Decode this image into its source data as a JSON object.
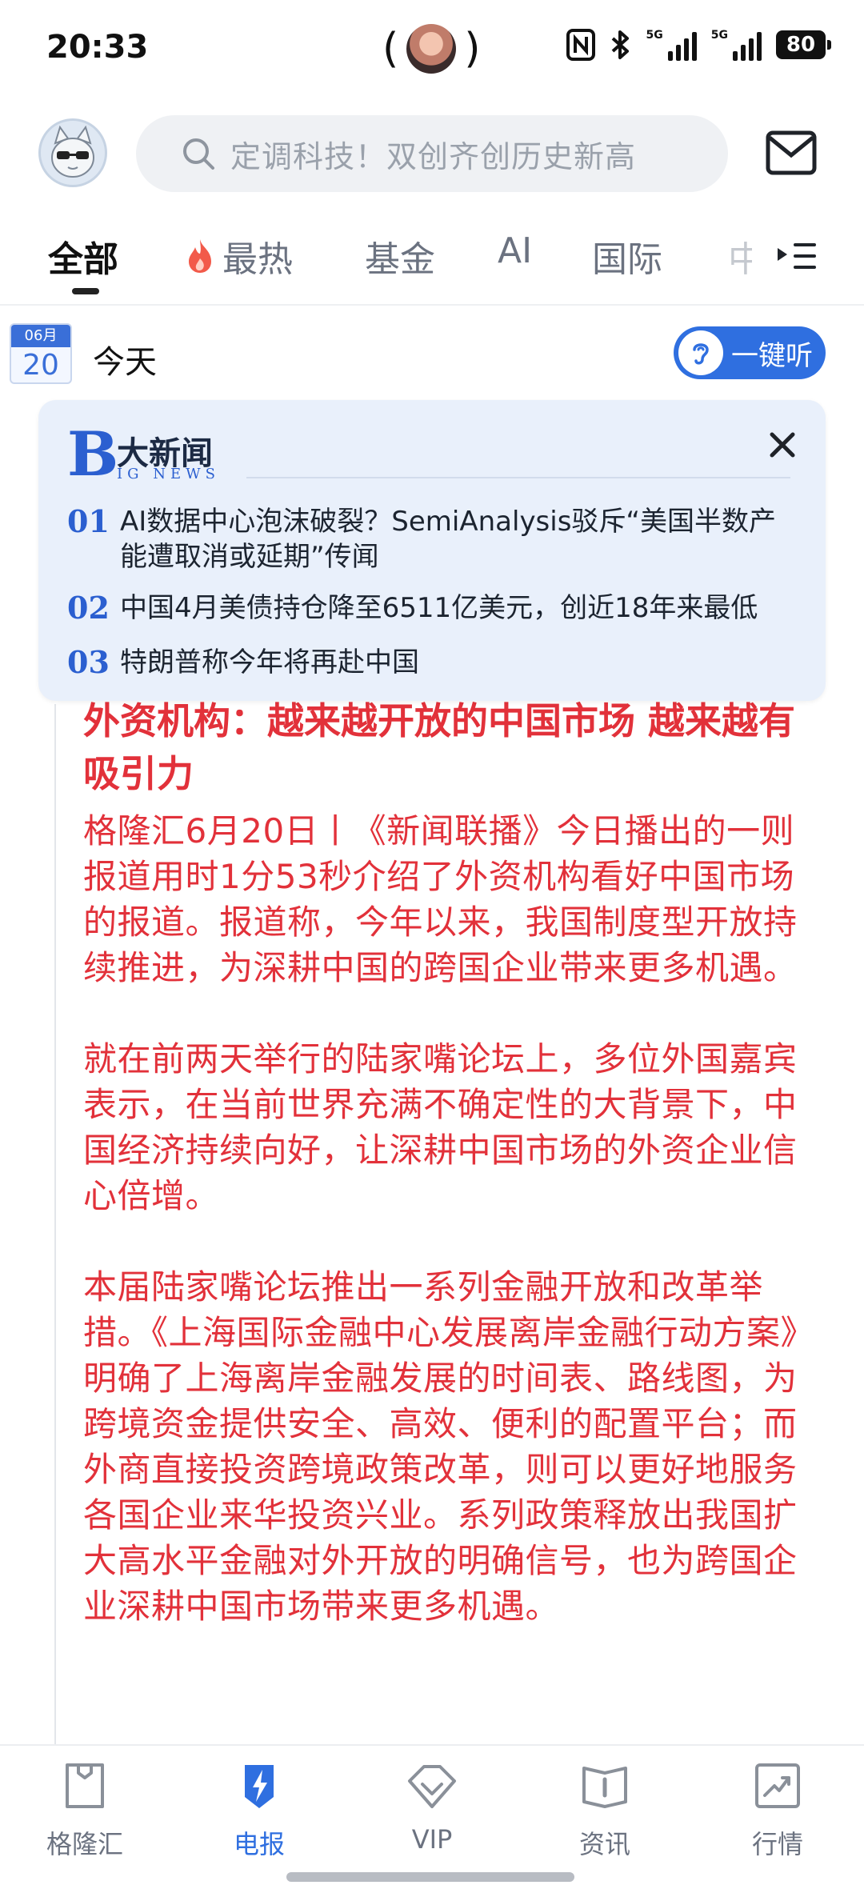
{
  "status_bar": {
    "time": "20:33",
    "network_1": "5G",
    "network_2": "5G",
    "battery": "80"
  },
  "header": {
    "search_placeholder": "定调科技！双创齐创历史新高"
  },
  "tabs": [
    {
      "label": "全部",
      "active": true
    },
    {
      "label": "最热"
    },
    {
      "label": "基金"
    },
    {
      "label": "AI"
    },
    {
      "label": "国际"
    },
    {
      "label": "中"
    }
  ],
  "date": {
    "month": "06月",
    "day": "20",
    "today_label": "今天",
    "listen_label": "一键听"
  },
  "big_news": {
    "logo_letter": "B",
    "logo_title": "大新闻",
    "logo_subtitle": "IG NEWS",
    "items": [
      {
        "num": "01",
        "text": "AI数据中心泡沫破裂？SemiAnalysis驳斥“美国半数产能遭取消或延期”传闻"
      },
      {
        "num": "02",
        "text": "中国4月美债持仓降至6511亿美元，创近18年来最低"
      },
      {
        "num": "03",
        "text": "特朗普称今年将再赴中国"
      }
    ]
  },
  "article": {
    "title": "外资机构：越来越开放的中国市场 越来越有吸引力",
    "paragraphs": [
      "格隆汇6月20日丨《新闻联播》今日播出的一则报道用时1分53秒介绍了外资机构看好中国市场的报道。报道称，今年以来，我国制度型开放持续推进，为深耕中国的跨国企业带来更多机遇。",
      "就在前两天举行的陆家嘴论坛上，多位外国嘉宾表示，在当前世界充满不确定性的大背景下，中国经济持续向好，让深耕中国市场的外资企业信心倍增。",
      "本届陆家嘴论坛推出一系列金融开放和改革举措。《上海国际金融中心发展离岸金融行动方案》明确了上海离岸金融发展的时间表、路线图，为跨境资金提供安全、高效、便利的配置平台；而外商直接投资跨境政策改革，则可以更好地服务各国企业来华投资兴业。系列政策释放出我国扩大高水平金融对外开放的明确信号，也为跨国企业深耕中国市场带来更多机遇。"
    ]
  },
  "bottom_nav": [
    {
      "label": "格隆汇",
      "icon": "bookmark-bag-icon"
    },
    {
      "label": "电报",
      "icon": "lightning-icon",
      "active": true
    },
    {
      "label": "VIP",
      "icon": "diamond-icon"
    },
    {
      "label": "资讯",
      "icon": "info-book-icon"
    },
    {
      "label": "行情",
      "icon": "chart-trend-icon"
    }
  ],
  "colors": {
    "accent_blue": "#2f6fe0",
    "headline_red": "#e2313a",
    "card_bg": "#e9f0fb"
  }
}
